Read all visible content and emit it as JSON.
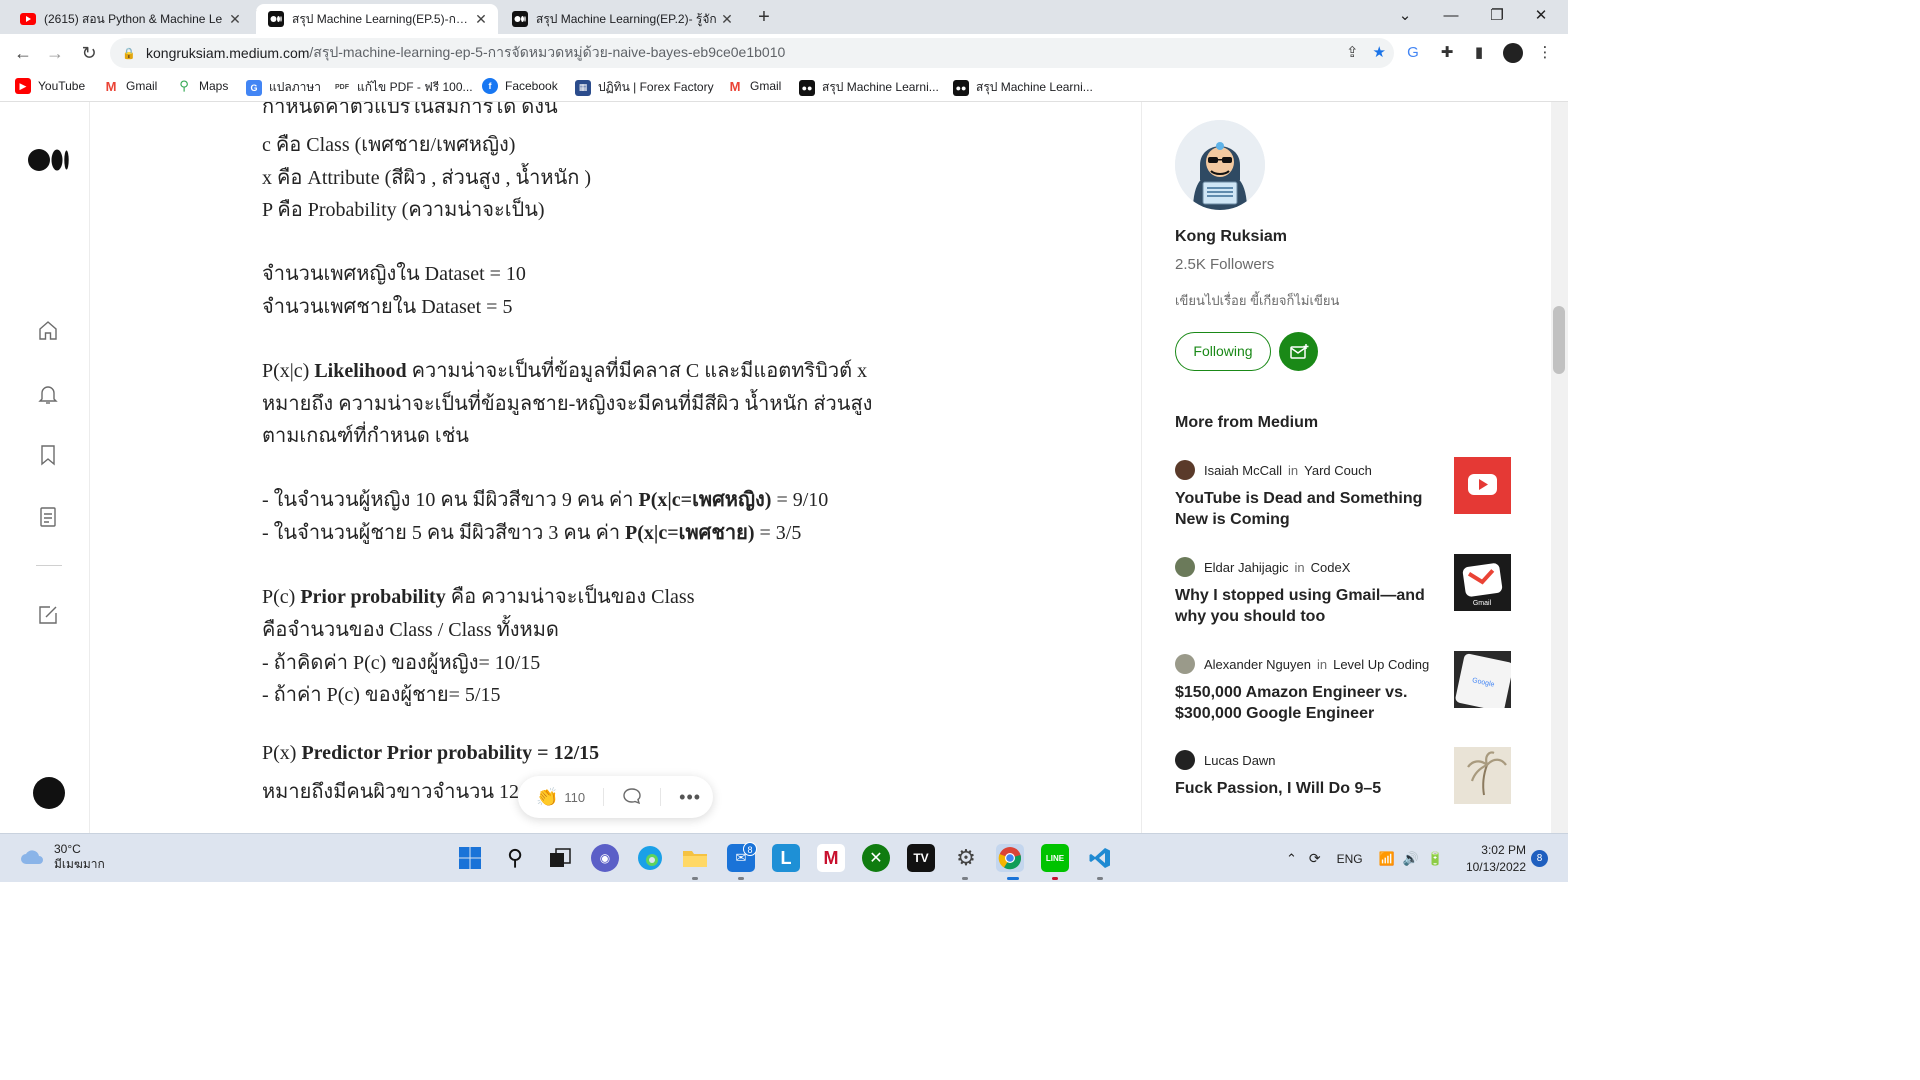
{
  "browser": {
    "tabs": [
      {
        "title": "(2615) สอน Python & Machine Le",
        "favicon": "youtube-icon",
        "active": false
      },
      {
        "title": "สรุป Machine Learning(EP.5)-การจั",
        "favicon": "medium-icon",
        "active": true
      },
      {
        "title": "สรุป Machine Learning(EP.2)- รู้จัก",
        "favicon": "medium-icon",
        "active": false
      }
    ],
    "new_tab_label": "+",
    "url_host": "kongruksiam.medium.com",
    "url_path": "/สรุป-machine-learning-ep-5-การจัดหมวดหมู่ด้วย-naive-bayes-eb9ce0e1b010",
    "bookmarks": [
      {
        "label": "YouTube",
        "icon": "youtube-icon",
        "color": "#ff0000"
      },
      {
        "label": "Gmail",
        "icon": "gmail-icon",
        "color": "#ea4335"
      },
      {
        "label": "Maps",
        "icon": "maps-icon",
        "color": "#34a853"
      },
      {
        "label": "แปลภาษา",
        "icon": "translate-icon",
        "color": "#4285f4"
      },
      {
        "label": "แก้ไข PDF - ฟรี 100...",
        "icon": "pdf-icon",
        "color": "#444444"
      },
      {
        "label": "Facebook",
        "icon": "facebook-icon",
        "color": "#1877f2"
      },
      {
        "label": "ปฏิทิน | Forex Factory",
        "icon": "forex-icon",
        "color": "#2b4c8c"
      },
      {
        "label": "Gmail",
        "icon": "gmail-icon",
        "color": "#ea4335"
      },
      {
        "label": "สรุป Machine Learni...",
        "icon": "medium-icon",
        "color": "#111111"
      },
      {
        "label": "สรุป Machine Learni...",
        "icon": "medium-icon",
        "color": "#111111"
      }
    ]
  },
  "article": {
    "partial_top": "กำหนดค่าตัวแปรในสมการได้ ดังนี้",
    "lines": [
      {
        "pre": "c คือ Class (เพศชาย/เพศหญิง)",
        "bold": "",
        "post": ""
      },
      {
        "pre": "x คือ Attribute (สีผิว , ส่วนสูง , น้ำหนัก )",
        "bold": "",
        "post": ""
      },
      {
        "pre": "P คือ Probability (ความน่าจะเป็น)",
        "bold": "",
        "post": ""
      },
      {
        "pre": "จำนวนเพศหญิงใน Dataset = 10",
        "bold": "",
        "post": ""
      },
      {
        "pre": "จำนวนเพศชายใน Dataset = 5",
        "bold": "",
        "post": ""
      },
      {
        "pre": "P(x|c) ",
        "bold": "Likelihood",
        "post": " ความน่าจะเป็นที่ข้อมูลที่มีคลาส C และมีแอตทริบิวต์ x"
      },
      {
        "pre": "หมายถึง ความน่าจะเป็นที่ข้อมูลชาย-หญิงจะมีคนที่มีสีผิว น้ำหนัก ส่วนสูง",
        "bold": "",
        "post": ""
      },
      {
        "pre": "ตามเกณฑ์ที่กำหนด เช่น",
        "bold": "",
        "post": ""
      },
      {
        "pre": "- ในจำนวนผู้หญิง 10 คน มีผิวสีขาว 9 คน ค่า ",
        "bold": "P(x|c=เพศหญิง)",
        "post": " = 9/10"
      },
      {
        "pre": "- ในจำนวนผู้ชาย 5 คน มีผิวสีขาว 3 คน ค่า ",
        "bold": "P(x|c=เพศชาย)",
        "post": " = 3/5"
      },
      {
        "pre": "P(c) ",
        "bold": "Prior probability",
        "post": " คือ ความน่าจะเป็นของ Class"
      },
      {
        "pre": "คือจำนวนของ Class / Class ทั้งหมด",
        "bold": "",
        "post": ""
      },
      {
        "pre": "- ถ้าคิดค่า P(c) ของผู้หญิง= 10/15",
        "bold": "",
        "post": ""
      },
      {
        "pre": "- ถ้าค่า P(c) ของผู้ชาย= 5/15",
        "bold": "",
        "post": ""
      },
      {
        "pre": "P(x) ",
        "bold": "Predictor Prior probability = 12/15",
        "post": ""
      },
      {
        "pre": "หมายถึงมีคนผิวขาวจำนวน 12 คน",
        "bold": "",
        "post": ""
      }
    ]
  },
  "clap_bar": {
    "claps": "110"
  },
  "sidebar": {
    "author_name": "Kong Ruksiam",
    "followers": "2.5K Followers",
    "bio": "เขียนไปเรื่อย ขี้เกียจก็ไม่เขียน",
    "following_label": "Following",
    "more_title": "More from Medium",
    "recommendations": [
      {
        "author": "Isaiah McCall",
        "in": "in",
        "publication": "Yard Couch",
        "title": "YouTube is Dead and Something New is Coming",
        "thumb": "youtube-thumb"
      },
      {
        "author": "Eldar Jahijagic",
        "in": "in",
        "publication": "CodeX",
        "title": "Why I stopped using Gmail—and why you should too",
        "thumb": "gmail-thumb",
        "thumb_label": "Gmail"
      },
      {
        "author": "Alexander Nguyen",
        "in": "in",
        "publication": "Level Up Coding",
        "title": "$150,000 Amazon Engineer vs. $300,000 Google Engineer",
        "thumb": "phone-google-thumb",
        "thumb_label": "Google"
      },
      {
        "author": "Lucas Dawn",
        "in": "",
        "publication": "",
        "title": "Fuck Passion, I Will Do 9–5",
        "thumb": "palm-thumb"
      }
    ]
  },
  "taskbar": {
    "temperature": "30°C",
    "weather": "มีเมฆมาก",
    "mail_badge": "8",
    "language": "ENG",
    "time": "3:02 PM",
    "date": "10/13/2022",
    "notifications": "8"
  },
  "colors": {
    "accent": "#1a8917",
    "taskbar": "#dde4ef",
    "tabstrip": "#dfe3e8"
  }
}
